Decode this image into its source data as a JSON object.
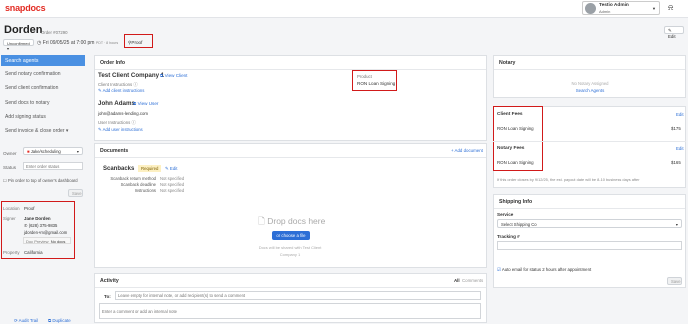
{
  "header": {
    "logo": "snapdocs",
    "user_name": "Testio Admin",
    "user_role": "Admin"
  },
  "order": {
    "title": "Dorden",
    "order_id": "Order #07290",
    "status_select": "Unconfirmed",
    "datetime": "Fri 09/05/25 at 7:00 pm",
    "tz": "PDT · 8 hours",
    "proof_badge": "Proof",
    "edit_label": "Edit"
  },
  "sidebar": {
    "items": [
      {
        "label": "Search agents"
      },
      {
        "label": "Send notary confirmation"
      },
      {
        "label": "Send client confirmation"
      },
      {
        "label": "Send docs to notary"
      },
      {
        "label": "Add signing status"
      },
      {
        "label": "Send invoice & close order"
      }
    ],
    "owner_label": "Owner",
    "owner_value": "Jake/scheduling",
    "status_label": "Status",
    "status_placeholder": "Enter order status",
    "pin_label": "Pin order to top of owner's dashboard",
    "save_label": "Save",
    "location_label": "Location",
    "location_value": "Proof",
    "signer_label": "Signer",
    "signer_name": "Jane Dorden",
    "signer_phone": "(628) 375-9835",
    "signer_email": "jdorden+m@gmail.com",
    "doc_preview_label": "Doc Preview",
    "doc_preview_value": "No docs",
    "property_label": "Property",
    "property_value": "California",
    "audit_trail": "Audit Trail",
    "duplicate": "Duplicate"
  },
  "order_info": {
    "heading": "Order Info",
    "client_name": "Test Client Company 1",
    "view_client": "View Client",
    "client_instructions_label": "Client Instructions",
    "add_client_instructions": "Add client instructions",
    "product_label": "Product",
    "product_value": "RON Loan Signing",
    "user_name": "John Adams",
    "view_user": "View User",
    "user_email": "john@adams-lending.com",
    "user_instructions_label": "User Instructions",
    "add_user_instructions": "Add user instructions"
  },
  "documents": {
    "heading": "Documents",
    "add_document": "+ Add document",
    "doc_name": "Scanbacks",
    "required": "Required",
    "edit": "Edit",
    "rows": [
      {
        "label": "Scanback return method",
        "value": "Not specified"
      },
      {
        "label": "Scanback deadline",
        "value": "Not specified"
      },
      {
        "label": "Instructions",
        "value": "Not specified"
      }
    ],
    "drop_title": "Drop docs here",
    "drop_button": "or choose a file",
    "drop_note_1": "Docs will be shared with Test Client",
    "drop_note_2": "Company 1"
  },
  "activity": {
    "heading": "Activity",
    "filter_all": "All",
    "filter_comments": "Comments",
    "to_label": "To:",
    "to_placeholder": "Leave empty for internal note, or add recipient(s) to send a comment",
    "comment_placeholder": "Enter a comment or add an internal note"
  },
  "notary": {
    "heading": "Notary",
    "none": "No Notary Assigned",
    "search_agents": "Search Agents"
  },
  "fees": {
    "client_heading": "Client Fees",
    "client_edit": "Edit",
    "client_item": "RON Loan Signing",
    "client_amount": "$175",
    "notary_heading": "Notary Fees",
    "notary_edit": "Edit",
    "notary_item": "RON Loan Signing",
    "notary_amount": "$165",
    "note": "If this order closes by 9/12/25, the est. payout date will be 8-10 business days after"
  },
  "shipping": {
    "heading": "Shipping Info",
    "service_label": "Service",
    "service_value": "Select Shipping Co",
    "tracking_label": "Tracking #",
    "auto_email": "Auto email for status 2 hours after appointment",
    "save_label": "Save"
  },
  "colors": {
    "brand": "#e32b23",
    "accent": "#2d6fd6",
    "highlight": "#d11a1a"
  }
}
